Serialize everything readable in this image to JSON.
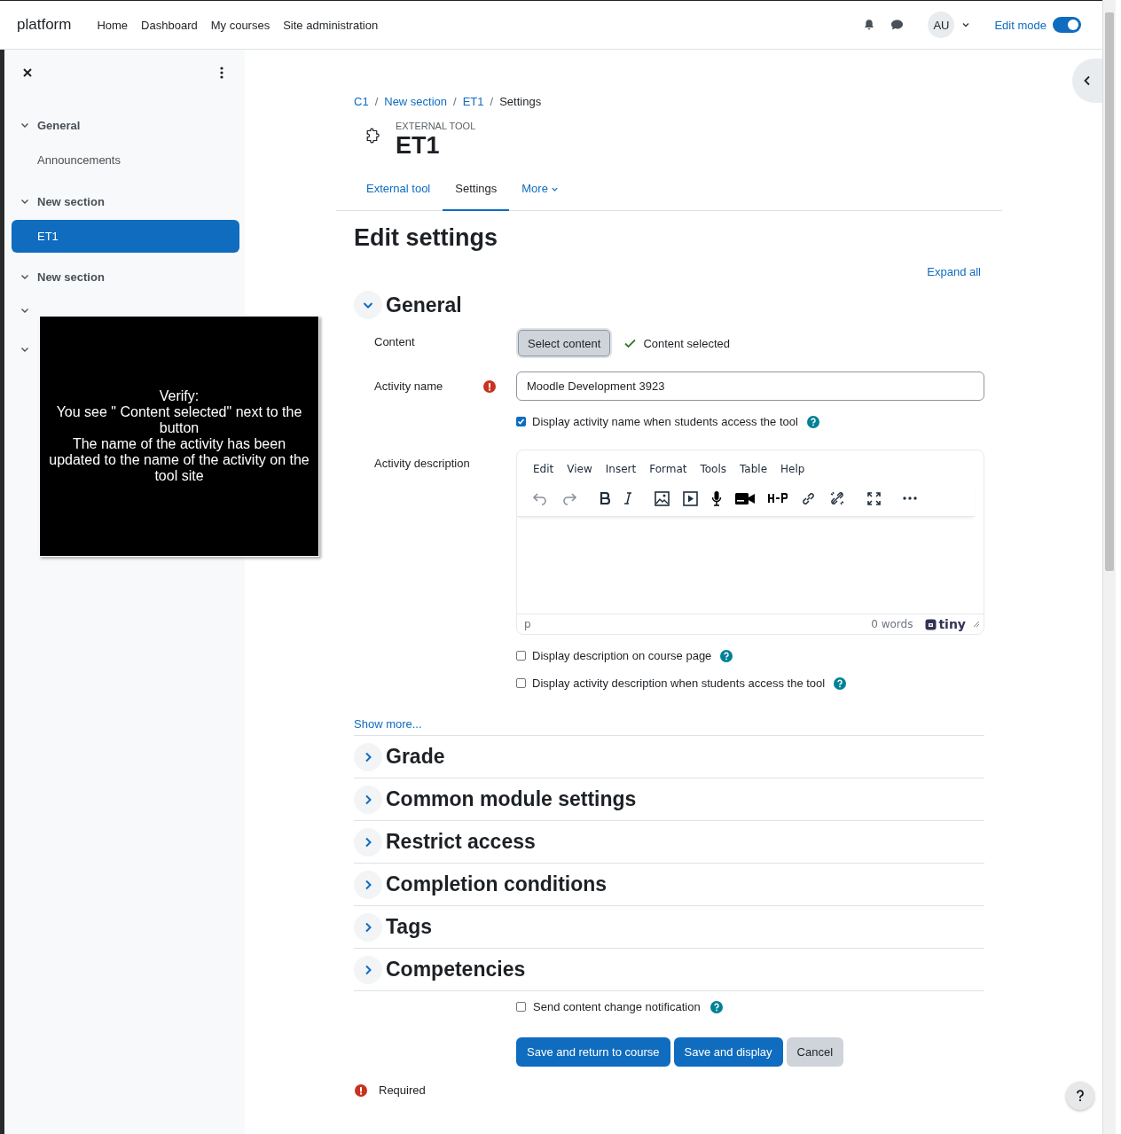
{
  "navbar": {
    "brand": "platform",
    "links": [
      "Home",
      "Dashboard",
      "My courses",
      "Site administration"
    ],
    "avatar": "AU",
    "edit_mode": {
      "label": "Edit mode",
      "on": true
    }
  },
  "sidebar": {
    "sections": [
      {
        "name": "General",
        "expanded": true,
        "children": [
          {
            "label": "Announcements",
            "selected": false
          }
        ]
      },
      {
        "name": "New section",
        "expanded": true,
        "children": [
          {
            "label": "ET1",
            "selected": true
          }
        ]
      },
      {
        "name": "New section",
        "expanded": true
      },
      {
        "expanded": true
      },
      {
        "expanded": true
      }
    ]
  },
  "overlay": {
    "lines": [
      "Verify:",
      "You see \" Content selected\" next to the button",
      "The name of the activity has been updated to the name of the activity on the tool site"
    ]
  },
  "breadcrumb": [
    {
      "kind": "link",
      "label": "C1"
    },
    {
      "kind": "separator",
      "label": "/"
    },
    {
      "kind": "link",
      "label": "New section"
    },
    {
      "kind": "separator",
      "label": "/"
    },
    {
      "kind": "link",
      "label": "ET1"
    },
    {
      "kind": "separator",
      "label": "/"
    },
    {
      "kind": "current",
      "label": "Settings"
    }
  ],
  "header": {
    "kicker": "EXTERNAL TOOL",
    "title": "ET1"
  },
  "tabs": [
    {
      "label": "External tool",
      "selected": false,
      "dropdown": false
    },
    {
      "label": "Settings",
      "selected": true,
      "dropdown": false
    },
    {
      "label": "More",
      "selected": false,
      "dropdown": true
    }
  ],
  "page_title": "Edit settings",
  "expand_all": "Expand all",
  "general": {
    "title": "General",
    "expanded": true,
    "fields": [
      {
        "kind": "content",
        "label": "Content",
        "button": "Select content",
        "status": "Content selected"
      },
      {
        "kind": "text",
        "label": "Activity name",
        "required": true,
        "value": "Moodle Development 3923"
      },
      {
        "kind": "checkbox",
        "label": "Display activity name when students access the tool",
        "checked": true,
        "help": true
      },
      {
        "kind": "editor",
        "label": "Activity description",
        "menu": [
          "Edit",
          "View",
          "Insert",
          "Format",
          "Tools",
          "Table",
          "Help"
        ],
        "path": "p",
        "word_count": "0 words",
        "brand": "tiny"
      },
      {
        "kind": "checkbox",
        "label": "Display description on course page",
        "checked": false,
        "help": true
      },
      {
        "kind": "checkbox",
        "label": "Display activity description when students access the tool",
        "checked": false,
        "help": true
      }
    ],
    "show_more": "Show more..."
  },
  "sections": [
    {
      "title": "Grade",
      "expanded": false
    },
    {
      "title": "Common module settings",
      "expanded": false
    },
    {
      "title": "Restrict access",
      "expanded": false
    },
    {
      "title": "Completion conditions",
      "expanded": false
    },
    {
      "title": "Tags",
      "expanded": false
    },
    {
      "title": "Competencies",
      "expanded": false
    }
  ],
  "notification": {
    "label": "Send content change notification",
    "checked": false,
    "help": true
  },
  "buttons": [
    {
      "label": "Save and return to course",
      "kind": "primary"
    },
    {
      "label": "Save and display",
      "kind": "primary"
    },
    {
      "label": "Cancel",
      "kind": "secondary"
    }
  ],
  "required_note": "Required"
}
